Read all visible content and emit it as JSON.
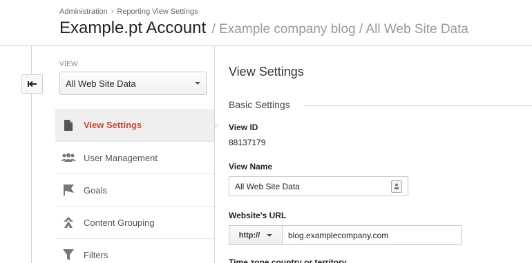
{
  "breadcrumb": {
    "items": [
      "Administration",
      "Reporting View Settings"
    ],
    "separator": "›"
  },
  "title": {
    "account": "Example.pt Account",
    "path": "/ Example company blog / All Web Site Data"
  },
  "view_selector": {
    "label": "VIEW",
    "selected": "All Web Site Data"
  },
  "side_nav": {
    "items": [
      {
        "label": "View Settings",
        "icon": "document-icon",
        "active": true
      },
      {
        "label": "User Management",
        "icon": "users-icon",
        "active": false
      },
      {
        "label": "Goals",
        "icon": "flag-icon",
        "active": false
      },
      {
        "label": "Content Grouping",
        "icon": "content-grouping-icon",
        "active": false
      },
      {
        "label": "Filters",
        "icon": "filter-icon",
        "active": false
      }
    ]
  },
  "main": {
    "title": "View Settings",
    "section": "Basic Settings",
    "view_id": {
      "label": "View ID",
      "value": "88137179"
    },
    "view_name": {
      "label": "View Name",
      "value": "All Web Site Data"
    },
    "website_url": {
      "label": "Website's URL",
      "protocol": "http://",
      "value": "blog.examplecompany.com"
    },
    "next_field_label": "Time zone country or territory"
  },
  "colors": {
    "active_nav_text": "#d14836",
    "active_nav_bg": "#efefef"
  }
}
